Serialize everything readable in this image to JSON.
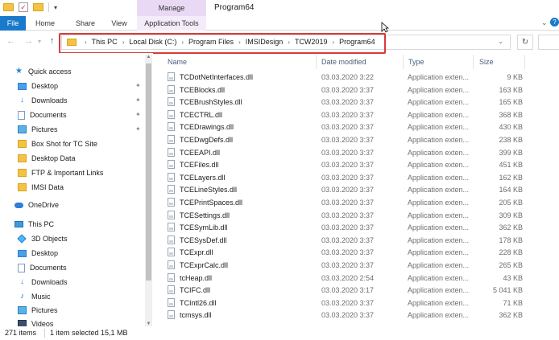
{
  "window": {
    "title": "Program64",
    "contextual_group": "Manage"
  },
  "ribbon": {
    "tabs": [
      {
        "label": "File"
      },
      {
        "label": "Home"
      },
      {
        "label": "Share"
      },
      {
        "label": "View"
      },
      {
        "label": "Application Tools"
      }
    ]
  },
  "address": {
    "crumbs": [
      "This PC",
      "Local Disk (C:)",
      "Program Files",
      "IMSIDesign",
      "TCW2019",
      "Program64"
    ]
  },
  "nav": {
    "quick_access": "Quick access",
    "quick_items": [
      {
        "label": "Desktop",
        "icon": "desktop-icon",
        "pinned": true
      },
      {
        "label": "Downloads",
        "icon": "download-icon",
        "pinned": true
      },
      {
        "label": "Documents",
        "icon": "documents-icon",
        "pinned": true
      },
      {
        "label": "Pictures",
        "icon": "pictures-icon",
        "pinned": true
      },
      {
        "label": "Box Shot for TC Site",
        "icon": "folder-icon",
        "pinned": false
      },
      {
        "label": "Desktop Data",
        "icon": "folder-icon",
        "pinned": false
      },
      {
        "label": "FTP & Important Links",
        "icon": "folder-icon",
        "pinned": false
      },
      {
        "label": "IMSI Data",
        "icon": "folder-icon",
        "pinned": false
      }
    ],
    "onedrive": "OneDrive",
    "this_pc": "This PC",
    "pc_items": [
      {
        "label": "3D Objects",
        "icon": "3d-objects-icon"
      },
      {
        "label": "Desktop",
        "icon": "desktop-icon"
      },
      {
        "label": "Documents",
        "icon": "documents-icon"
      },
      {
        "label": "Downloads",
        "icon": "download-icon"
      },
      {
        "label": "Music",
        "icon": "music-icon"
      },
      {
        "label": "Pictures",
        "icon": "pictures-icon"
      },
      {
        "label": "Videos",
        "icon": "videos-icon"
      }
    ]
  },
  "columns": {
    "name": "Name",
    "date": "Date modified",
    "type": "Type",
    "size": "Size"
  },
  "files": [
    {
      "name": "TCDotNetInterfaces.dll",
      "date": "03.03.2020 3:22",
      "type": "Application exten...",
      "size": "9 KB"
    },
    {
      "name": "TCEBlocks.dll",
      "date": "03.03.2020 3:37",
      "type": "Application exten...",
      "size": "163 KB"
    },
    {
      "name": "TCEBrushStyles.dll",
      "date": "03.03.2020 3:37",
      "type": "Application exten...",
      "size": "165 KB"
    },
    {
      "name": "TCECTRL.dll",
      "date": "03.03.2020 3:37",
      "type": "Application exten...",
      "size": "368 KB"
    },
    {
      "name": "TCEDrawings.dll",
      "date": "03.03.2020 3:37",
      "type": "Application exten...",
      "size": "430 KB"
    },
    {
      "name": "TCEDwgDefs.dll",
      "date": "03.03.2020 3:37",
      "type": "Application exten...",
      "size": "238 KB"
    },
    {
      "name": "TCEEAPI.dll",
      "date": "03.03.2020 3:37",
      "type": "Application exten...",
      "size": "399 KB"
    },
    {
      "name": "TCEFiles.dll",
      "date": "03.03.2020 3:37",
      "type": "Application exten...",
      "size": "451 KB"
    },
    {
      "name": "TCELayers.dll",
      "date": "03.03.2020 3:37",
      "type": "Application exten...",
      "size": "162 KB"
    },
    {
      "name": "TCELineStyles.dll",
      "date": "03.03.2020 3:37",
      "type": "Application exten...",
      "size": "164 KB"
    },
    {
      "name": "TCEPrintSpaces.dll",
      "date": "03.03.2020 3:37",
      "type": "Application exten...",
      "size": "205 KB"
    },
    {
      "name": "TCESettings.dll",
      "date": "03.03.2020 3:37",
      "type": "Application exten...",
      "size": "309 KB"
    },
    {
      "name": "TCESymLib.dll",
      "date": "03.03.2020 3:37",
      "type": "Application exten...",
      "size": "362 KB"
    },
    {
      "name": "TCESysDef.dll",
      "date": "03.03.2020 3:37",
      "type": "Application exten...",
      "size": "178 KB"
    },
    {
      "name": "TCExpr.dll",
      "date": "03.03.2020 3:37",
      "type": "Application exten...",
      "size": "228 KB"
    },
    {
      "name": "TCExprCalc.dll",
      "date": "03.03.2020 3:37",
      "type": "Application exten...",
      "size": "265 KB"
    },
    {
      "name": "tcHeap.dll",
      "date": "03.03.2020 2:54",
      "type": "Application exten...",
      "size": "43 KB"
    },
    {
      "name": "TCIFC.dll",
      "date": "03.03.2020 3:17",
      "type": "Application exten...",
      "size": "5 041 KB"
    },
    {
      "name": "TCIntl26.dll",
      "date": "03.03.2020 3:37",
      "type": "Application exten...",
      "size": "71 KB"
    },
    {
      "name": "tcmsys.dll",
      "date": "03.03.2020 3:37",
      "type": "Application exten...",
      "size": "362 KB"
    }
  ],
  "status": {
    "items": "271 items",
    "selected": "1 item selected  15,1 MB"
  },
  "colors": {
    "file_tab": "#1979ca",
    "manage_tab": "#e9d9f5",
    "highlight_border": "#d93a3a",
    "header_text": "#4c607a"
  }
}
